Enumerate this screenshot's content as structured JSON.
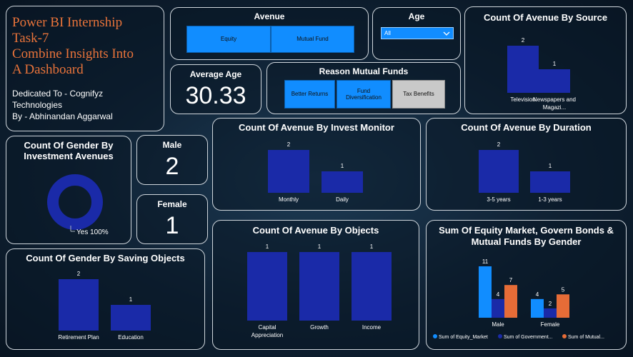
{
  "header": {
    "title_lines": [
      "Power BI Internship",
      "Task-7",
      "Combine Insights Into",
      "A Dashboard"
    ],
    "dedication": "Dedicated To - Cognifyz",
    "dedication2": "Technologies",
    "author": "By - Abhinandan Aggarwal"
  },
  "avenue_slicer": {
    "title": "Avenue",
    "options": [
      "Equity",
      "Mutual Fund"
    ]
  },
  "age_slicer": {
    "title": "Age",
    "value": "All"
  },
  "average_age": {
    "title": "Average Age",
    "value": "30.33"
  },
  "reason_slicer": {
    "title": "Reason Mutual Funds",
    "options": [
      "Better Returns",
      "Fund Diversification",
      "Tax Benefits"
    ]
  },
  "male": {
    "label": "Male",
    "value": "2"
  },
  "female": {
    "label": "Female",
    "value": "1"
  },
  "donut": {
    "title": "Count Of Gender By Investment Avenues",
    "legend": "Yes 100%"
  },
  "colors": {
    "bar": "#1a2aa8",
    "light_blue": "#118dff",
    "orange": "#e66c37"
  },
  "chart_data": [
    {
      "id": "source",
      "type": "bar",
      "title": "Count Of Avenue By Source",
      "categories": [
        "Television",
        "Newspapers and Magazi..."
      ],
      "values": [
        2,
        1
      ]
    },
    {
      "id": "monitor",
      "type": "bar",
      "title": "Count Of Avenue By Invest Monitor",
      "categories": [
        "Monthly",
        "Daily"
      ],
      "values": [
        2,
        1
      ]
    },
    {
      "id": "duration",
      "type": "bar",
      "title": "Count Of Avenue By Duration",
      "categories": [
        "3-5 years",
        "1-3 years"
      ],
      "values": [
        2,
        1
      ]
    },
    {
      "id": "saving",
      "type": "bar",
      "title": "Count Of Gender By Saving Objects",
      "categories": [
        "Retirement Plan",
        "Education"
      ],
      "values": [
        2,
        1
      ]
    },
    {
      "id": "objects",
      "type": "bar",
      "title": "Count Of Avenue By Objects",
      "categories": [
        "Capital Appreciation",
        "Growth",
        "Income"
      ],
      "values": [
        1,
        1,
        1
      ]
    },
    {
      "id": "sums",
      "type": "bar",
      "title": "Sum Of Equity Market, Govern Bonds & Mutual Funds By Gender",
      "categories": [
        "Male",
        "Female"
      ],
      "series": [
        {
          "name": "Sum of Equity_Market",
          "values": [
            11,
            4
          ]
        },
        {
          "name": "Sum of Government...",
          "values": [
            4,
            2
          ]
        },
        {
          "name": "Sum of Mutual...",
          "values": [
            7,
            5
          ]
        }
      ]
    }
  ]
}
